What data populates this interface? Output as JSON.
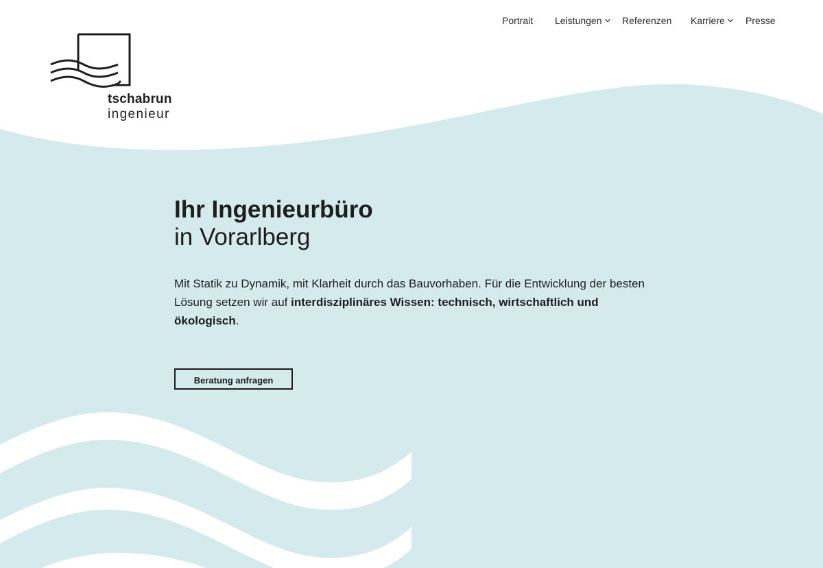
{
  "colors": {
    "wave_light": "#d5eaed",
    "background": "#ffffff",
    "text": "#1e1e1e"
  },
  "logo": {
    "line1": "tschabrun",
    "line2": "ingenieur"
  },
  "nav": {
    "items": [
      {
        "label": "Portrait",
        "has_dropdown": false
      },
      {
        "label": "Leistungen",
        "has_dropdown": true
      },
      {
        "label": "Referenzen",
        "has_dropdown": false
      },
      {
        "label": "Karriere",
        "has_dropdown": true
      },
      {
        "label": "Presse",
        "has_dropdown": false
      }
    ]
  },
  "hero": {
    "title_strong": "Ihr Ingenieurbüro",
    "title_light": "in Vorarlberg",
    "text_part1": "Mit Statik zu Dynamik, mit Klarheit durch das Bauvorhaben. Für die Entwicklung der besten Lösung setzen wir auf ",
    "text_bold": "interdisziplinäres Wissen: technisch, wirtschaftlich und ökologisch",
    "text_part2": ".",
    "cta_label": "Beratung anfragen"
  },
  "icons": {
    "logo_mark": "logo-waves-square-icon",
    "dropdown": "chevron-down-icon"
  }
}
